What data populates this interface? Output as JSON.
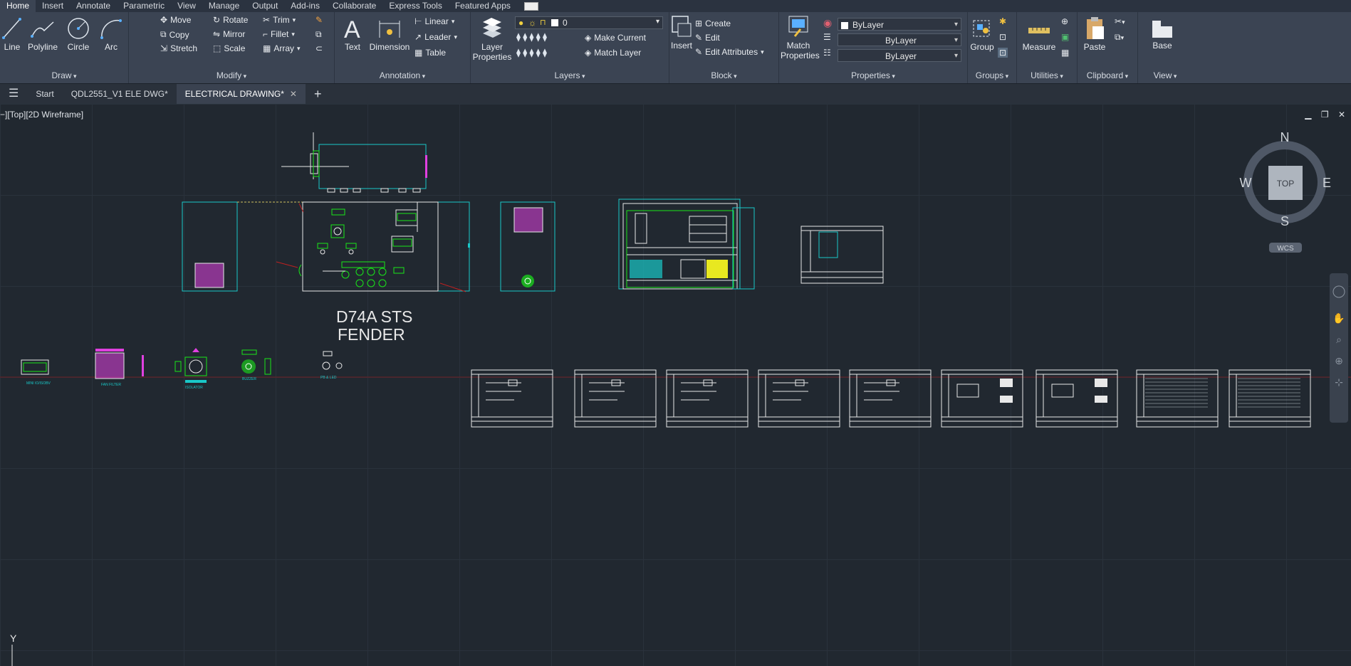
{
  "ribbon_tabs": [
    "Home",
    "Insert",
    "Annotate",
    "Parametric",
    "View",
    "Manage",
    "Output",
    "Add-ins",
    "Collaborate",
    "Express Tools",
    "Featured Apps"
  ],
  "active_tab": "Home",
  "panels": {
    "draw": {
      "title": "Draw",
      "line": "Line",
      "polyline": "Polyline",
      "circle": "Circle",
      "arc": "Arc"
    },
    "modify": {
      "title": "Modify",
      "move": "Move",
      "rotate": "Rotate",
      "trim": "Trim",
      "copy": "Copy",
      "mirror": "Mirror",
      "fillet": "Fillet",
      "stretch": "Stretch",
      "scale": "Scale",
      "array": "Array"
    },
    "annotation": {
      "title": "Annotation",
      "text": "Text",
      "dimension": "Dimension",
      "linear": "Linear",
      "leader": "Leader",
      "table": "Table"
    },
    "layers": {
      "title": "Layers",
      "layer_properties": "Layer Properties",
      "current_layer": "0",
      "make_current": "Make Current",
      "match_layer": "Match Layer"
    },
    "block": {
      "title": "Block",
      "insert": "Insert",
      "create": "Create",
      "edit": "Edit",
      "edit_attributes": "Edit Attributes"
    },
    "properties": {
      "title": "Properties",
      "match_properties": "Match Properties",
      "color": "ByLayer",
      "linetype": "ByLayer",
      "lineweight": "ByLayer"
    },
    "groups": {
      "title": "Groups",
      "group": "Group"
    },
    "utilities": {
      "title": "Utilities",
      "measure": "Measure"
    },
    "clipboard": {
      "title": "Clipboard",
      "paste": "Paste"
    },
    "view": {
      "title": "View",
      "base": "Base"
    }
  },
  "file_tabs": {
    "start": "Start",
    "doc1": "QDL2551_V1 ELE DWG*",
    "doc2": "ELECTRICAL DRAWING*"
  },
  "viewport": {
    "label": "−][Top][2D Wireframe]"
  },
  "viewcube": {
    "n": "N",
    "s": "S",
    "e": "E",
    "w": "W",
    "top": "TOP",
    "wcs": "WCS"
  },
  "drawing": {
    "title_line1": "D74A STS",
    "title_line2": "FENDER",
    "components": [
      "MINI IO/ISOBV",
      "FAN FILTER",
      "ISOLATOR",
      "BUZZER",
      "PB & LED"
    ]
  },
  "ucs": {
    "y": "Y"
  },
  "colors": {
    "background": "#212830",
    "ribbon": "#3b4453",
    "cyan": "#19c8c8",
    "green": "#19e619",
    "magenta": "#e040e0",
    "white": "#e8e8e8",
    "red": "#c02020"
  }
}
